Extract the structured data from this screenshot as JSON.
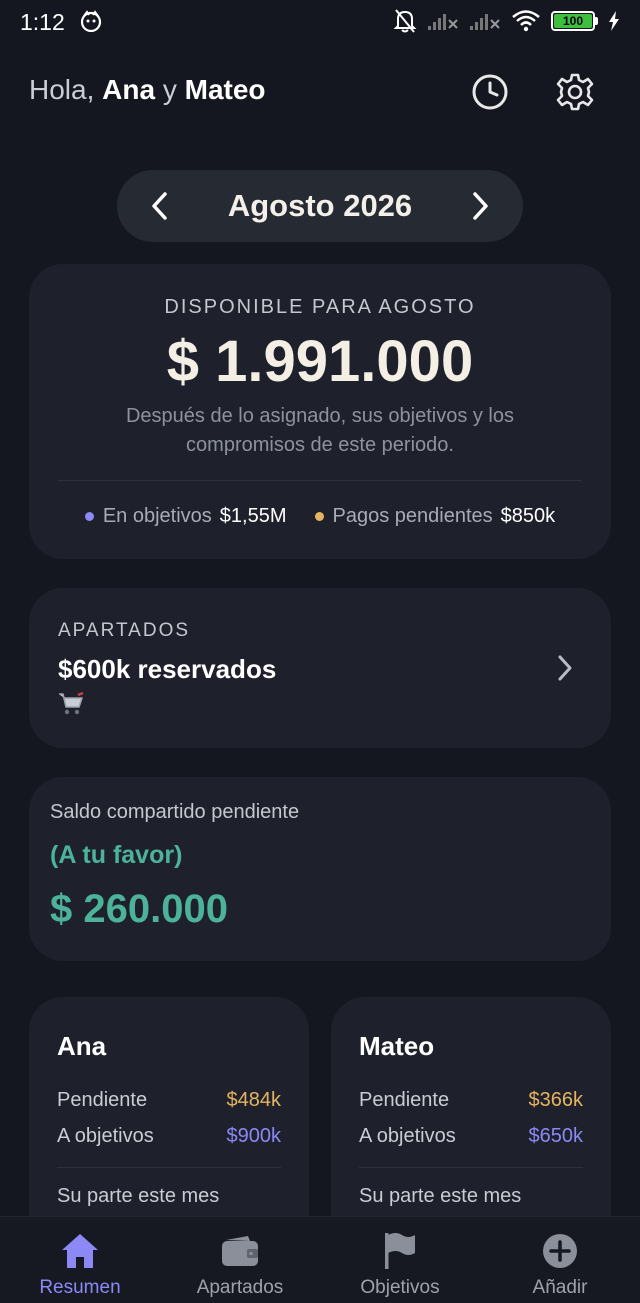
{
  "status_bar": {
    "time": "1:12",
    "battery": "100"
  },
  "header": {
    "greeting_prefix": "Hola,",
    "name1": "Ana",
    "connector": "y",
    "name2": "Mateo"
  },
  "month_selector": {
    "label": "Agosto 2026"
  },
  "available": {
    "label": "DISPONIBLE PARA AGOSTO",
    "amount": "$ 1.991.000",
    "description": "Después de lo asignado, sus objetivos y los compromisos de este periodo.",
    "stats": [
      {
        "label": "En objetivos",
        "value": "$1,55M",
        "color": "#8c88f5"
      },
      {
        "label": "Pagos pendientes",
        "value": "$850k",
        "color": "#e5b460"
      }
    ]
  },
  "apartados": {
    "label": "APARTADOS",
    "title": "$600k reservados",
    "icon": "cart-icon"
  },
  "saldo": {
    "label": "Saldo compartido pendiente",
    "status": "(A tu favor)",
    "amount": "$ 260.000",
    "color": "#4cb39a"
  },
  "people": [
    {
      "name": "Ana",
      "pending_label": "Pendiente",
      "pending_value": "$484k",
      "goals_label": "A objetivos",
      "goals_value": "$900k",
      "share_label": "Su parte este mes"
    },
    {
      "name": "Mateo",
      "pending_label": "Pendiente",
      "pending_value": "$366k",
      "goals_label": "A objetivos",
      "goals_value": "$650k",
      "share_label": "Su parte este mes"
    }
  ],
  "nav": {
    "items": [
      {
        "label": "Resumen",
        "icon": "home-icon",
        "active": true
      },
      {
        "label": "Apartados",
        "icon": "wallet-icon",
        "active": false
      },
      {
        "label": "Objetivos",
        "icon": "flag-icon",
        "active": false
      },
      {
        "label": "Añadir",
        "icon": "add-circle-icon",
        "active": false
      }
    ],
    "active_color": "#8c88f5"
  }
}
